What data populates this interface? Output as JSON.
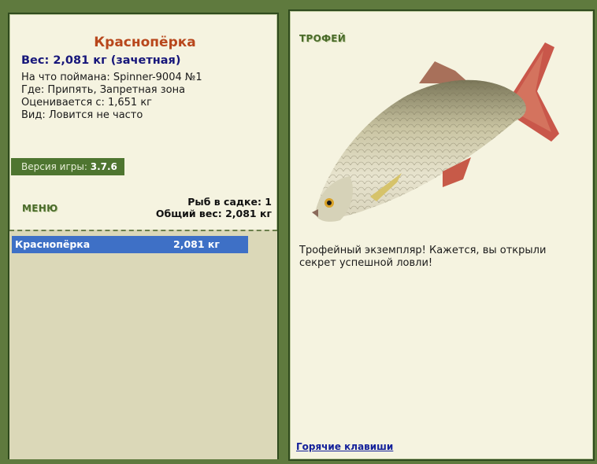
{
  "fish": {
    "name": "Краснопёрка",
    "weight_line": "Вес: 2,081 кг (зачетная)",
    "caught_on": "На что поймана: Spinner-9004 №1",
    "where": "Где: Припять, Запретная зона",
    "valued_from": "Оценивается с: 1,651 кг",
    "type": "Вид: Ловится не часто"
  },
  "version": {
    "label": "Версия игры:",
    "value": "3.7.6"
  },
  "menu": {
    "label": "МЕНЮ"
  },
  "stats": {
    "fish_count": "Рыб в садке: 1",
    "total_weight": "Общий вес: 2,081 кг"
  },
  "keepnet": {
    "items": [
      {
        "name": "Краснопёрка",
        "weight": "2,081 кг"
      }
    ]
  },
  "trophy": {
    "title": "ТРОФЕЙ",
    "text": "Трофейный экземпляр! Кажется, вы открыли секрет успешной ловли!"
  },
  "hotkeys": {
    "label": "Горячие клавиши"
  },
  "colors": {
    "background": "#5f7a3e",
    "panel": "#f5f3e0",
    "title": "#b8471c",
    "weight": "#16167a",
    "selection": "#3e70c6",
    "version_bar": "#4e7530"
  }
}
